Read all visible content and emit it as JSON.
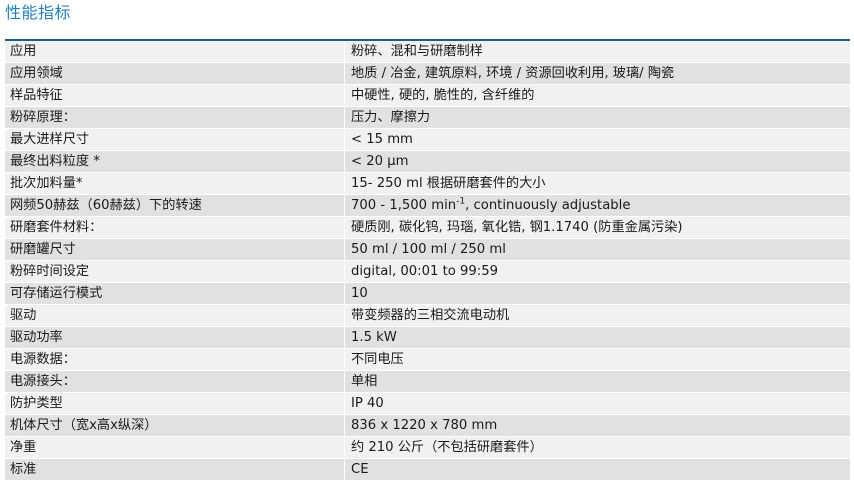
{
  "page": {
    "title": "性能指标"
  },
  "rows": [
    {
      "label": "应用",
      "value": "粉碎、混和与研磨制样"
    },
    {
      "label": "应用领域",
      "value": "地质 / 冶金, 建筑原料, 环境 / 资源回收利用, 玻璃/ 陶瓷"
    },
    {
      "label": "样品特征",
      "value": "中硬性, 硬的, 脆性的, 含纤维的"
    },
    {
      "label": "粉碎原理：",
      "value": "压力、摩擦力"
    },
    {
      "label": "最大进样尺寸",
      "value": "< 15 mm"
    },
    {
      "label": "最终出料粒度 *",
      "value": "< 20 µm"
    },
    {
      "label": "批次加料量*",
      "value": "15- 250 ml 根据研磨套件的大小"
    },
    {
      "label": "网频50赫兹（60赫兹）下的转速",
      "value": "700 - 1,500 min",
      "sup": "-1",
      "suffix": ", continuously adjustable"
    },
    {
      "label": "研磨套件材料：",
      "value": "硬质刚, 碳化钨, 玛瑙, 氧化锆, 钢1.1740 (防重金属污染)"
    },
    {
      "label": "研磨罐尺寸",
      "value": "50 ml / 100 ml / 250 ml"
    },
    {
      "label": "粉碎时间设定",
      "value": "digital, 00:01 to 99:59"
    },
    {
      "label": "可存储运行模式",
      "value": "10"
    },
    {
      "label": "驱动",
      "value": "带变频器的三相交流电动机"
    },
    {
      "label": "驱动功率",
      "value": "1.5 kW"
    },
    {
      "label": "电源数据：",
      "value": "不同电压"
    },
    {
      "label": "电源接头：",
      "value": "单相"
    },
    {
      "label": "防护类型",
      "value": "IP 40"
    },
    {
      "label": "机体尺寸（宽x高x纵深）",
      "value": "836 x 1220 x 780 mm"
    },
    {
      "label": "净重",
      "value": "约 210 公斤（不包括研磨套件）"
    },
    {
      "label": "标准",
      "value": "CE"
    }
  ]
}
